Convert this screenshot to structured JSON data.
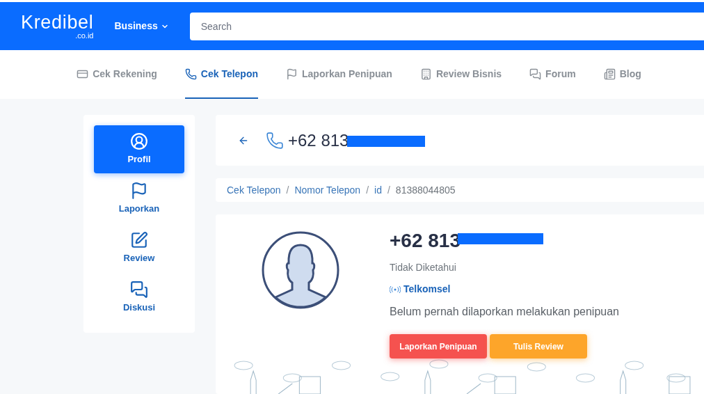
{
  "header": {
    "logo": "Kredibel",
    "logo_suffix": ".co.id",
    "menu": "Business",
    "search": {
      "placeholder": "Search"
    }
  },
  "nav": [
    {
      "label": "Cek Rekening",
      "selected": false
    },
    {
      "label": "Cek Telepon",
      "selected": true
    },
    {
      "label": "Laporkan Penipuan",
      "selected": false
    },
    {
      "label": "Review Bisnis",
      "selected": false
    },
    {
      "label": "Forum",
      "selected": false
    },
    {
      "label": "Blog",
      "selected": false
    }
  ],
  "sidebar": [
    {
      "label": "Profil",
      "selected": true
    },
    {
      "label": "Laporkan",
      "selected": false
    },
    {
      "label": "Review",
      "selected": false
    },
    {
      "label": "Diskusi",
      "selected": false
    }
  ],
  "title": "+62 813",
  "breadcrumb": [
    {
      "label": "Cek Telepon",
      "kind": "link"
    },
    {
      "separator": "/",
      "label": "Nomor Telepon",
      "kind": "link"
    },
    {
      "separator": "/",
      "label": "id",
      "kind": "link"
    },
    {
      "separator": "/",
      "label": "81388044805",
      "kind": "current"
    }
  ],
  "profile": {
    "number": "+62 813",
    "name": "Tidak Diketahui",
    "operator": "Telkomsel",
    "status": "Belum pernah dilaporkan melakukan penipuan"
  },
  "buttons": [
    {
      "label": "Laporkan Penipuan",
      "kind": "danger"
    },
    {
      "label": "Tulis Review",
      "kind": "warning"
    }
  ]
}
